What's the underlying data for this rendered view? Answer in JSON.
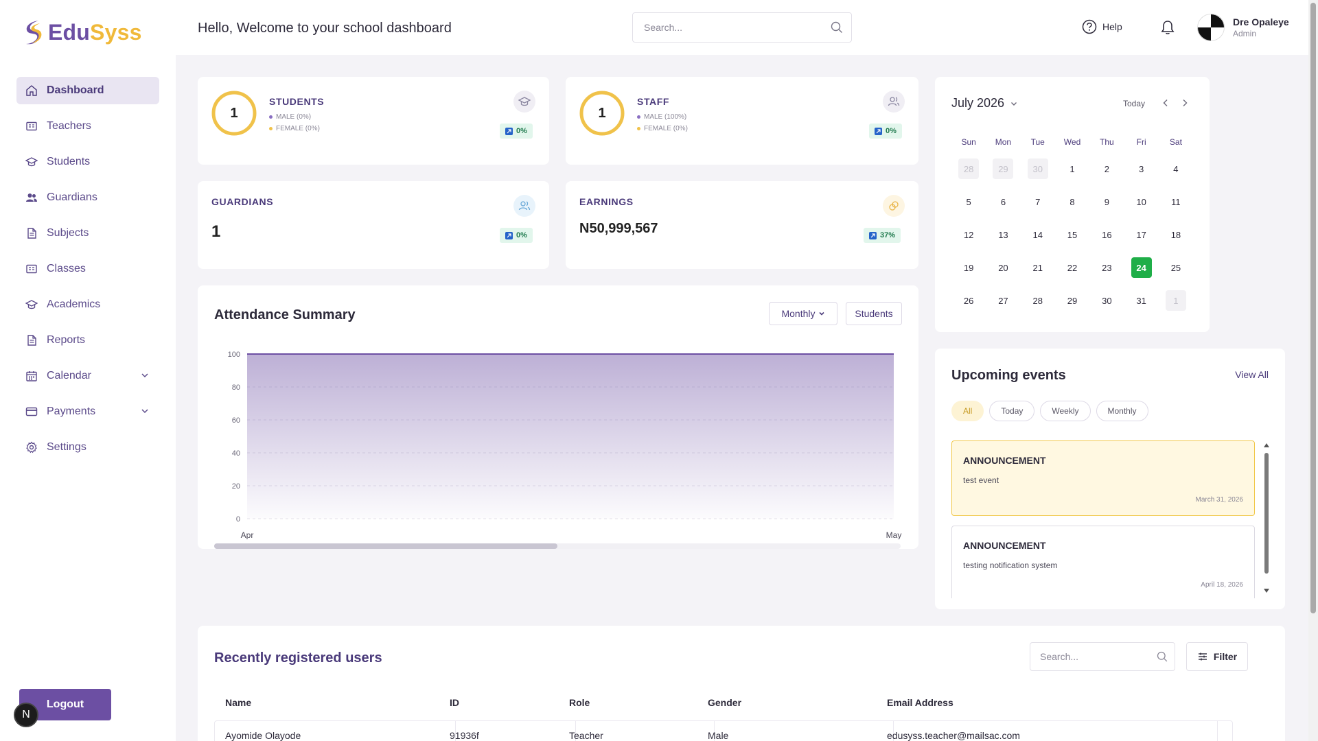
{
  "brand": {
    "part1": "Edu",
    "part2": "Syss",
    "color_primary": "#6c4fa3",
    "color_accent": "#f0b93a"
  },
  "header": {
    "greeting": "Hello, Welcome to your school dashboard",
    "search_placeholder": "Search...",
    "help_label": "Help",
    "user_name": "Dre Opaleye",
    "user_role": "Admin"
  },
  "sidebar": {
    "items": [
      {
        "label": "Dashboard",
        "icon": "home-icon",
        "active": true
      },
      {
        "label": "Teachers",
        "icon": "id-card-icon"
      },
      {
        "label": "Students",
        "icon": "graduation-cap-icon"
      },
      {
        "label": "Guardians",
        "icon": "users-icon"
      },
      {
        "label": "Subjects",
        "icon": "document-icon"
      },
      {
        "label": "Classes",
        "icon": "id-card-icon"
      },
      {
        "label": "Academics",
        "icon": "graduation-cap-icon"
      },
      {
        "label": "Reports",
        "icon": "document-icon"
      },
      {
        "label": "Calendar",
        "icon": "calendar-icon",
        "expandable": true
      },
      {
        "label": "Payments",
        "icon": "credit-card-icon",
        "expandable": true
      },
      {
        "label": "Settings",
        "icon": "gear-icon"
      }
    ],
    "logout_label": "Logout",
    "avatar_letter": "N"
  },
  "stats": {
    "students": {
      "title": "STUDENTS",
      "value": "1",
      "male": "MALE (0%)",
      "female": "FEMALE (0%)",
      "change": "0%"
    },
    "staff": {
      "title": "STAFF",
      "value": "1",
      "male": "MALE (100%)",
      "female": "FEMALE (0%)",
      "change": "0%"
    },
    "guardians": {
      "title": "GUARDIANS",
      "value": "1",
      "change": "0%"
    },
    "earnings": {
      "title": "EARNINGS",
      "value": "N50,999,567",
      "change": "37%"
    }
  },
  "attendance": {
    "title": "Attendance Summary",
    "period_label": "Monthly",
    "audience_label": "Students"
  },
  "chart_data": {
    "type": "area",
    "x": [
      "Apr",
      "May"
    ],
    "series": [
      {
        "values": [
          100,
          100
        ]
      }
    ],
    "yticks": [
      0,
      20,
      40,
      60,
      80,
      100
    ],
    "ylim": [
      0,
      100
    ],
    "grid": true,
    "color": "#6c4fa3"
  },
  "calendar": {
    "month_label": "July 2026",
    "today_label": "Today",
    "weekdays": [
      "Sun",
      "Mon",
      "Tue",
      "Wed",
      "Thu",
      "Fri",
      "Sat"
    ],
    "weeks": [
      [
        {
          "d": "28",
          "m": true
        },
        {
          "d": "29",
          "m": true
        },
        {
          "d": "30",
          "m": true
        },
        {
          "d": "1"
        },
        {
          "d": "2"
        },
        {
          "d": "3"
        },
        {
          "d": "4"
        }
      ],
      [
        {
          "d": "5"
        },
        {
          "d": "6"
        },
        {
          "d": "7"
        },
        {
          "d": "8"
        },
        {
          "d": "9"
        },
        {
          "d": "10"
        },
        {
          "d": "11"
        }
      ],
      [
        {
          "d": "12"
        },
        {
          "d": "13"
        },
        {
          "d": "14"
        },
        {
          "d": "15"
        },
        {
          "d": "16"
        },
        {
          "d": "17"
        },
        {
          "d": "18"
        }
      ],
      [
        {
          "d": "19"
        },
        {
          "d": "20"
        },
        {
          "d": "21"
        },
        {
          "d": "22"
        },
        {
          "d": "23"
        },
        {
          "d": "24",
          "s": true
        },
        {
          "d": "25"
        }
      ],
      [
        {
          "d": "26"
        },
        {
          "d": "27"
        },
        {
          "d": "28"
        },
        {
          "d": "29"
        },
        {
          "d": "30"
        },
        {
          "d": "31"
        },
        {
          "d": "1",
          "m": true
        }
      ]
    ]
  },
  "events": {
    "title": "Upcoming events",
    "view_all": "View All",
    "filters": [
      {
        "label": "All",
        "active": true
      },
      {
        "label": "Today"
      },
      {
        "label": "Weekly"
      },
      {
        "label": "Monthly"
      }
    ],
    "items": [
      {
        "type": "ANNOUNCEMENT",
        "text": "test event",
        "date": "March 31, 2026",
        "highlight": true
      },
      {
        "type": "ANNOUNCEMENT",
        "text": "testing notification system",
        "date": "April 18, 2026"
      }
    ]
  },
  "users": {
    "title": "Recently registered users",
    "search_placeholder": "Search...",
    "filter_label": "Filter",
    "columns": [
      "Name",
      "ID",
      "Role",
      "Gender",
      "Email Address"
    ],
    "rows": [
      [
        "Ayomide Olayode",
        "91936f",
        "Teacher",
        "Male",
        "edusyss.teacher@mailsac.com"
      ]
    ]
  }
}
